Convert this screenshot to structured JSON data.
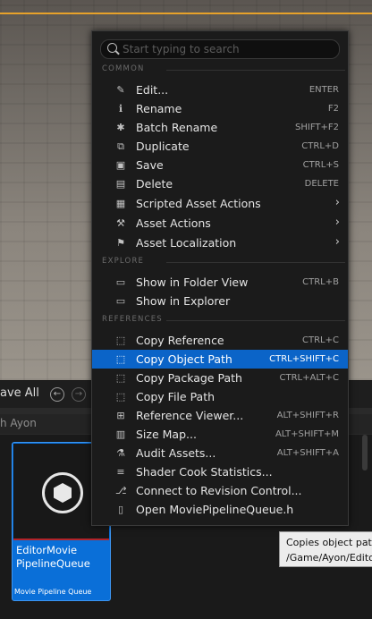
{
  "toolbar": {
    "save_all": "ave All"
  },
  "pathbar": {
    "text": "h Ayon"
  },
  "asset": {
    "name": "EditorMovie PipelineQueue",
    "type": "Movie Pipeline Queue"
  },
  "menu": {
    "search_placeholder": "Start typing to search",
    "sections": {
      "common": "COMMON",
      "explore": "EXPLORE",
      "references": "REFERENCES"
    },
    "items": [
      {
        "label": "Edit...",
        "shortcut": "ENTER",
        "icon": "pencil-icon"
      },
      {
        "label": "Rename",
        "shortcut": "F2",
        "icon": "rename-icon"
      },
      {
        "label": "Batch Rename",
        "shortcut": "SHIFT+F2",
        "icon": "sparkle-icon"
      },
      {
        "label": "Duplicate",
        "shortcut": "CTRL+D",
        "icon": "duplicate-icon"
      },
      {
        "label": "Save",
        "shortcut": "CTRL+S",
        "icon": "save-icon"
      },
      {
        "label": "Delete",
        "shortcut": "DELETE",
        "icon": "trash-icon"
      },
      {
        "label": "Scripted Asset Actions",
        "shortcut": "",
        "icon": "grid-icon",
        "submenu": true
      },
      {
        "label": "Asset Actions",
        "shortcut": "",
        "icon": "wrench-icon",
        "submenu": true
      },
      {
        "label": "Asset Localization",
        "shortcut": "",
        "icon": "flag-icon",
        "submenu": true
      },
      {
        "label": "Show in Folder View",
        "shortcut": "CTRL+B",
        "icon": "folder-search-icon"
      },
      {
        "label": "Show in Explorer",
        "shortcut": "",
        "icon": "folder-search-icon"
      },
      {
        "label": "Copy Reference",
        "shortcut": "CTRL+C",
        "icon": "copy-icon"
      },
      {
        "label": "Copy Object Path",
        "shortcut": "CTRL+SHIFT+C",
        "icon": "copy-icon"
      },
      {
        "label": "Copy Package Path",
        "shortcut": "CTRL+ALT+C",
        "icon": "copy-icon"
      },
      {
        "label": "Copy File Path",
        "shortcut": "",
        "icon": "copy-icon"
      },
      {
        "label": "Reference Viewer...",
        "shortcut": "ALT+SHIFT+R",
        "icon": "reference-viewer-icon"
      },
      {
        "label": "Size Map...",
        "shortcut": "ALT+SHIFT+M",
        "icon": "size-map-icon"
      },
      {
        "label": "Audit Assets...",
        "shortcut": "ALT+SHIFT+A",
        "icon": "audit-icon"
      },
      {
        "label": "Shader Cook Statistics...",
        "shortcut": "",
        "icon": "chart-icon"
      },
      {
        "label": "Connect to Revision Control...",
        "shortcut": "",
        "icon": "branch-icon"
      },
      {
        "label": "Open MoviePipelineQueue.h",
        "shortcut": "",
        "icon": "cpp-file-icon"
      }
    ]
  },
  "tooltip": {
    "line1": "Copies object path",
    "line2": "/Game/Ayon/Editor"
  },
  "colors": {
    "highlight": "#0b64c8",
    "accent": "#e7a22a",
    "tile": "#0a6fd8"
  }
}
